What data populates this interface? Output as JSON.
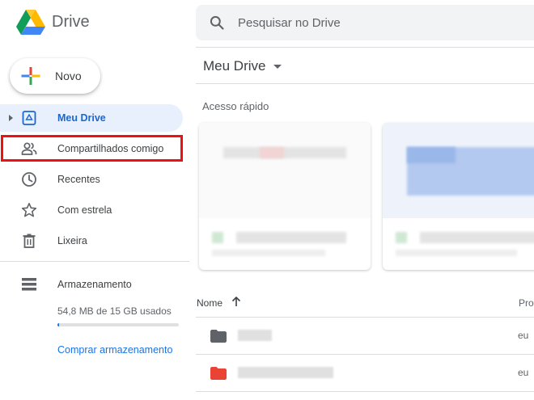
{
  "app": {
    "brand": "Drive"
  },
  "search": {
    "placeholder": "Pesquisar no Drive"
  },
  "sidebar": {
    "new_label": "Novo",
    "items": [
      {
        "label": "Meu Drive",
        "icon": "drive-folder-icon",
        "active": true
      },
      {
        "label": "Compartilhados comigo",
        "icon": "people-icon",
        "active": false
      },
      {
        "label": "Recentes",
        "icon": "clock-icon",
        "active": false
      },
      {
        "label": "Com estrela",
        "icon": "star-icon",
        "active": false
      },
      {
        "label": "Lixeira",
        "icon": "trash-icon",
        "active": false
      }
    ],
    "storage": {
      "label": "Armazenamento",
      "usage": "54,8 MB de 15 GB usados",
      "fraction": 0.0037,
      "buy_label": "Comprar armazenamento"
    }
  },
  "main": {
    "title": "Meu Drive",
    "quick_access_label": "Acesso rápido",
    "list": {
      "col_name": "Nome",
      "col_owner": "Pro",
      "rows": [
        {
          "folder_color": "#5f6368",
          "owner": "eu"
        },
        {
          "folder_color": "#ea4335",
          "owner": "eu"
        }
      ]
    }
  },
  "colors": {
    "accent": "#1a73e8",
    "active_bg": "#e8f0fe",
    "highlight": "#ee1111"
  }
}
